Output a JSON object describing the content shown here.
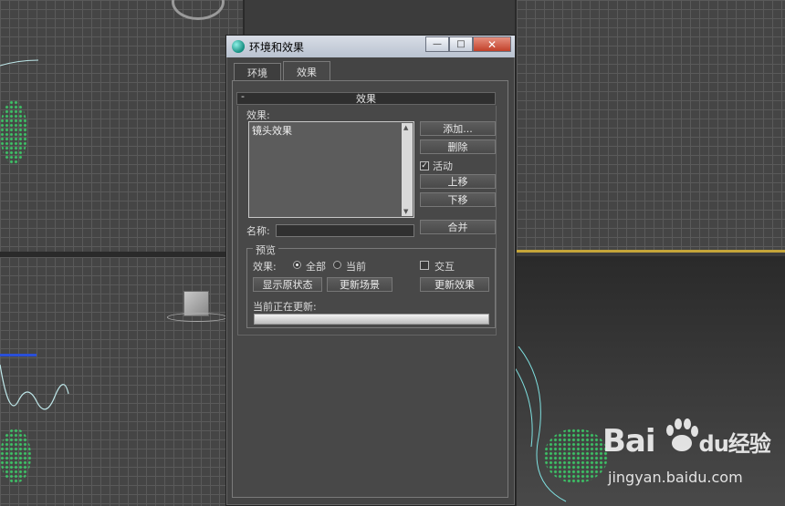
{
  "window": {
    "title": "环境和效果",
    "minimize": "—",
    "maximize": "□",
    "close": "✕"
  },
  "tabs": [
    {
      "label": "环境"
    },
    {
      "label": "效果"
    }
  ],
  "rollout": {
    "collapse": "-",
    "title": "效果"
  },
  "effects": {
    "label": "效果:",
    "items": [
      "镜头效果"
    ],
    "buttons": {
      "add": "添加...",
      "delete": "删除",
      "active": "活动",
      "move_up": "上移",
      "move_down": "下移",
      "merge": "合并"
    },
    "active_checked": true,
    "name_label": "名称:",
    "name_value": ""
  },
  "preview": {
    "title": "预览",
    "effects_label": "效果:",
    "radio_all": "全部",
    "radio_current": "当前",
    "selected": "全部",
    "interactive": "交互",
    "interactive_checked": false,
    "show_original": "显示原状态",
    "update_scene": "更新场景",
    "update_effect": "更新效果",
    "updating_label": "当前正在更新:"
  },
  "watermark": {
    "logo_left": "Bai",
    "logo_mid": "du",
    "logo_right": "经验",
    "url": "jingyan.baidu.com"
  }
}
